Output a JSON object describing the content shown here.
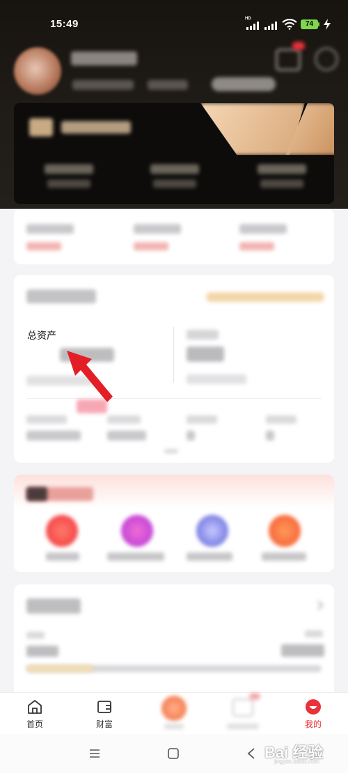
{
  "status_bar": {
    "time": "15:49",
    "battery": "74"
  },
  "assets": {
    "total_label": "总资产"
  },
  "bottom_nav": {
    "home_label": "首页",
    "wealth_label": "财富",
    "mine_label": "我的"
  },
  "watermark": {
    "text": "Bai 经验",
    "sub": "jingyan.baidu.com"
  },
  "colors": {
    "accent": "#e8323a",
    "vip_gold": "#e2b58a",
    "header_dark": "#1b1712"
  }
}
